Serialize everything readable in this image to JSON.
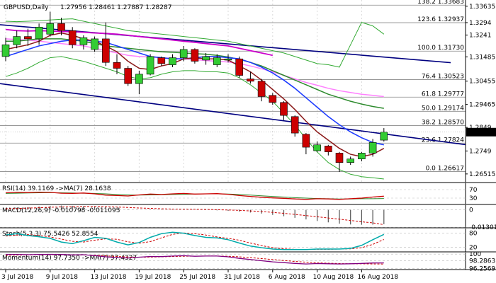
{
  "colors": {
    "bull": "#33cc33",
    "bear": "#cc0000",
    "wick": "#000000",
    "channel": "#000080",
    "ma_blue": "#1e3cff",
    "ma_brown": "#8b1a1a",
    "ma_green": "#2e8b2e",
    "ma_magenta": "#cc00cc",
    "ma_pink": "#ff80ff",
    "band_green": "#33aa33",
    "fib": "#888888",
    "grid": "#d8d8d8",
    "rsi_line": "#cc0000",
    "rsi_ma": "#2e8b2e",
    "stoch_k": "#00aaaa",
    "stoch_d": "#cc0000",
    "mom": "#800080",
    "mom_ma": "#cc0000",
    "price_tag": "#000000"
  },
  "header": {
    "symbol": "GBPUSD,Daily",
    "ohlc": "1.27956 1.28461 1.27887 1.28287"
  },
  "indicators": {
    "rsi": {
      "label": "RSI(14) 39.1169 ->MA(7) 28.1638",
      "ticks": [
        "70",
        "30"
      ]
    },
    "macd": {
      "label": "MACD(12,26,9) -0.010798 -0.011093",
      "ticks": [
        "0",
        "-0.01301"
      ]
    },
    "stoch": {
      "label": "Stoch(5,3,3) 75.5426 52.8554",
      "ticks": [
        "80",
        "20"
      ]
    },
    "momentum": {
      "label": "Momentum(14) 97.7350 ->MA(7) 97.4327",
      "ticks": [
        "100",
        "98.2863",
        "96.2569"
      ]
    }
  },
  "current_price": "1.28287",
  "chart_data": {
    "type": "candlestick",
    "title": "GBPUSD,Daily",
    "y_ticks": [
      1.33635,
      1.3294,
      1.3241,
      1.31485,
      1.30455,
      1.29465,
      1.2849,
      1.2749,
      1.26515
    ],
    "ylim": [
      1.2615,
      1.339
    ],
    "x_ticks": [
      "3 Jul 2018",
      "9 Jul 2018",
      "13 Jul 2018",
      "19 Jul 2018",
      "25 Jul 2018",
      "31 Jul 2018",
      "6 Aug 2018",
      "10 Aug 2018",
      "16 Aug 2018"
    ],
    "x_tick_index": [
      0,
      4,
      8,
      12,
      16,
      20,
      24,
      28,
      32
    ],
    "candles": [
      {
        "o": 1.315,
        "h": 1.323,
        "l": 1.313,
        "c": 1.32
      },
      {
        "o": 1.32,
        "h": 1.326,
        "l": 1.3185,
        "c": 1.3235
      },
      {
        "o": 1.3235,
        "h": 1.3268,
        "l": 1.3195,
        "c": 1.3225
      },
      {
        "o": 1.3225,
        "h": 1.329,
        "l": 1.32,
        "c": 1.3275
      },
      {
        "o": 1.3245,
        "h": 1.334,
        "l": 1.3235,
        "c": 1.329
      },
      {
        "o": 1.329,
        "h": 1.3315,
        "l": 1.324,
        "c": 1.326
      },
      {
        "o": 1.326,
        "h": 1.3275,
        "l": 1.3185,
        "c": 1.32
      },
      {
        "o": 1.32,
        "h": 1.324,
        "l": 1.318,
        "c": 1.323
      },
      {
        "o": 1.318,
        "h": 1.3235,
        "l": 1.317,
        "c": 1.3225
      },
      {
        "o": 1.3225,
        "h": 1.3295,
        "l": 1.311,
        "c": 1.3125
      },
      {
        "o": 1.3125,
        "h": 1.316,
        "l": 1.3075,
        "c": 1.31
      },
      {
        "o": 1.31,
        "h": 1.311,
        "l": 1.3025,
        "c": 1.3035
      },
      {
        "o": 1.3035,
        "h": 1.309,
        "l": 1.299,
        "c": 1.3075
      },
      {
        "o": 1.3075,
        "h": 1.316,
        "l": 1.307,
        "c": 1.315
      },
      {
        "o": 1.3145,
        "h": 1.315,
        "l": 1.311,
        "c": 1.312
      },
      {
        "o": 1.3115,
        "h": 1.316,
        "l": 1.3105,
        "c": 1.3145
      },
      {
        "o": 1.3145,
        "h": 1.3195,
        "l": 1.313,
        "c": 1.318
      },
      {
        "o": 1.318,
        "h": 1.3185,
        "l": 1.312,
        "c": 1.313
      },
      {
        "o": 1.3135,
        "h": 1.3165,
        "l": 1.3115,
        "c": 1.315
      },
      {
        "o": 1.3115,
        "h": 1.316,
        "l": 1.3105,
        "c": 1.3145
      },
      {
        "o": 1.3135,
        "h": 1.316,
        "l": 1.3125,
        "c": 1.314
      },
      {
        "o": 1.314,
        "h": 1.315,
        "l": 1.306,
        "c": 1.307
      },
      {
        "o": 1.3055,
        "h": 1.3085,
        "l": 1.3035,
        "c": 1.3045
      },
      {
        "o": 1.3045,
        "h": 1.3055,
        "l": 1.296,
        "c": 1.298
      },
      {
        "o": 1.2985,
        "h": 1.2995,
        "l": 1.2945,
        "c": 1.2955
      },
      {
        "o": 1.2955,
        "h": 1.296,
        "l": 1.288,
        "c": 1.29
      },
      {
        "o": 1.2895,
        "h": 1.29,
        "l": 1.281,
        "c": 1.2825
      },
      {
        "o": 1.282,
        "h": 1.2825,
        "l": 1.2735,
        "c": 1.2765
      },
      {
        "o": 1.275,
        "h": 1.279,
        "l": 1.2745,
        "c": 1.2775
      },
      {
        "o": 1.277,
        "h": 1.2775,
        "l": 1.273,
        "c": 1.2745
      },
      {
        "o": 1.274,
        "h": 1.2745,
        "l": 1.266,
        "c": 1.27
      },
      {
        "o": 1.27,
        "h": 1.2725,
        "l": 1.269,
        "c": 1.2715
      },
      {
        "o": 1.2715,
        "h": 1.2745,
        "l": 1.2705,
        "c": 1.274
      },
      {
        "o": 1.274,
        "h": 1.28,
        "l": 1.2725,
        "c": 1.2785
      },
      {
        "o": 1.2795,
        "h": 1.2846,
        "l": 1.2789,
        "c": 1.2829
      }
    ],
    "fib_levels": [
      {
        "label": "138.2 1.33683",
        "value": 1.33683
      },
      {
        "label": "123.6 1.32937",
        "value": 1.32937
      },
      {
        "label": "100.0 1.31730",
        "value": 1.3173
      },
      {
        "label": "76.4 1.30523",
        "value": 1.30523
      },
      {
        "label": "61.8 1.29777",
        "value": 1.29777
      },
      {
        "label": "50.0 1.29174",
        "value": 1.29174
      },
      {
        "label": "38.2 1.28570",
        "value": 1.2857
      },
      {
        "label": "23.6 1.27824",
        "value": 1.27824
      },
      {
        "label": "0.0 1.26617",
        "value": 1.26617
      }
    ],
    "channel_upper": [
      1.3285,
      1.3124
    ],
    "channel_lower": [
      1.3035,
      1.2776
    ],
    "ma_fast": [
      1.318,
      1.319,
      1.32,
      1.3215,
      1.324,
      1.325,
      1.324,
      1.3225,
      1.3215,
      1.3195,
      1.317,
      1.313,
      1.31,
      1.3095,
      1.311,
      1.312,
      1.314,
      1.3145,
      1.314,
      1.314,
      1.3135,
      1.311,
      1.3085,
      1.305,
      1.301,
      1.297,
      1.2925,
      1.2875,
      1.283,
      1.2795,
      1.276,
      1.2735,
      1.2725,
      1.2735,
      1.276
    ],
    "ma_blue": [
      1.315,
      1.3165,
      1.318,
      1.3195,
      1.3205,
      1.3215,
      1.322,
      1.322,
      1.3215,
      1.321,
      1.3195,
      1.318,
      1.3165,
      1.315,
      1.3145,
      1.314,
      1.314,
      1.3145,
      1.315,
      1.315,
      1.3145,
      1.314,
      1.3125,
      1.3105,
      1.308,
      1.305,
      1.3015,
      1.2975,
      1.2935,
      1.2895,
      1.286,
      1.283,
      1.2805,
      1.2785,
      1.2775
    ],
    "ma_green": [
      1.3215,
      1.3215,
      1.322,
      1.3225,
      1.3225,
      1.3225,
      1.322,
      1.3215,
      1.3205,
      1.3195,
      1.319,
      1.3185,
      1.318,
      1.3175,
      1.317,
      1.3168,
      1.3165,
      1.3162,
      1.316,
      1.3155,
      1.3148,
      1.3138,
      1.3125,
      1.311,
      1.309,
      1.307,
      1.305,
      1.303,
      1.301,
      1.299,
      1.2975,
      1.296,
      1.2948,
      1.2938,
      1.293
    ],
    "ma_magenta": [
      1.3265,
      1.326,
      1.3258,
      1.326,
      1.3258,
      1.3256,
      1.3255,
      1.3253,
      1.325,
      1.3248,
      1.3245,
      1.324,
      1.3235,
      1.323,
      1.3225,
      1.322,
      1.3215,
      1.321,
      1.3205,
      1.32,
      1.3195,
      1.3185,
      1.3175,
      1.3165,
      1.3155
    ],
    "ma_pink": [
      1.3225,
      1.3222,
      1.322,
      1.3215,
      1.321,
      1.3205,
      1.32,
      1.3195,
      1.3185,
      1.3175,
      1.3165,
      1.3155,
      1.315,
      1.3148,
      1.3145,
      1.3142,
      1.314,
      1.3137,
      1.3133,
      1.313,
      1.3127,
      1.312,
      1.311,
      1.3098,
      1.3085,
      1.307,
      1.3055,
      1.304,
      1.3028,
      1.3015,
      1.3005,
      1.2997,
      1.299,
      1.2985,
      1.298
    ],
    "band_upper": [
      1.33,
      1.3298,
      1.33,
      1.3302,
      1.3305,
      1.3308,
      1.331,
      1.33,
      1.329,
      1.328,
      1.327,
      1.326,
      1.3255,
      1.325,
      1.3245,
      1.324,
      1.3235,
      1.323,
      1.3225,
      1.322,
      1.3215,
      1.3205,
      1.3195,
      1.3185,
      1.3175,
      1.3165,
      1.315,
      1.3135,
      1.312,
      1.3115,
      1.3105,
      1.32,
      1.3295,
      1.328,
      1.3245
    ],
    "band_lower": [
      1.3065,
      1.308,
      1.31,
      1.3125,
      1.3145,
      1.315,
      1.314,
      1.313,
      1.3115,
      1.31,
      1.3085,
      1.3065,
      1.3055,
      1.306,
      1.3075,
      1.3085,
      1.309,
      1.309,
      1.3085,
      1.3085,
      1.308,
      1.306,
      1.303,
      1.2995,
      1.296,
      1.291,
      1.286,
      1.28,
      1.2745,
      1.27,
      1.267,
      1.265,
      1.264,
      1.2635,
      1.263
    ],
    "rsi": {
      "ylim": [
        0,
        100
      ],
      "rsi": [
        55,
        57,
        56,
        58,
        57,
        53,
        52,
        54,
        50,
        44,
        42,
        40,
        45,
        49,
        47,
        50,
        52,
        49,
        50,
        51,
        48,
        42,
        38,
        34,
        31,
        29,
        26,
        24,
        27,
        26,
        24,
        27,
        30,
        35,
        39
      ],
      "ma": [
        52,
        53,
        54,
        55,
        56,
        55,
        54,
        53,
        52,
        50,
        47,
        45,
        44,
        45,
        46,
        47,
        48,
        49,
        50,
        50,
        49,
        47,
        44,
        41,
        38,
        35,
        32,
        30,
        28,
        27,
        26,
        26,
        27,
        27,
        28
      ]
    },
    "macd": {
      "hist": [
        0.001,
        0.0015,
        0.002,
        0.0025,
        0.003,
        0.0032,
        0.003,
        0.0028,
        0.0025,
        0.002,
        0.0012,
        0.0004,
        0.0,
        -0.0002,
        -0.0002,
        -0.0001,
        0.0,
        0.0,
        -0.0002,
        -0.0004,
        -0.0008,
        -0.0013,
        -0.002,
        -0.0028,
        -0.0038,
        -0.0048,
        -0.006,
        -0.0072,
        -0.0084,
        -0.0094,
        -0.0104,
        -0.011,
        -0.0112,
        -0.0111,
        -0.0108
      ],
      "signal": [
        0.0008,
        0.001,
        0.0013,
        0.0016,
        0.0019,
        0.0022,
        0.0024,
        0.0025,
        0.0025,
        0.0024,
        0.0021,
        0.0018,
        0.0014,
        0.0011,
        0.0008,
        0.0006,
        0.0005,
        0.0004,
        0.0003,
        0.0001,
        -0.0001,
        -0.0004,
        -0.0008,
        -0.0013,
        -0.0019,
        -0.0026,
        -0.0034,
        -0.0043,
        -0.0052,
        -0.0061,
        -0.007,
        -0.008,
        -0.009,
        -0.0098,
        -0.0111
      ],
      "ylim": [
        -0.0135,
        0.0035
      ]
    },
    "stoch": {
      "ylim": [
        0,
        100
      ],
      "k": [
        72,
        78,
        70,
        65,
        58,
        42,
        35,
        48,
        62,
        58,
        42,
        30,
        40,
        62,
        78,
        84,
        80,
        70,
        62,
        60,
        52,
        38,
        25,
        18,
        12,
        10,
        10,
        10,
        12,
        12,
        12,
        15,
        28,
        52,
        75
      ],
      "d": [
        68,
        72,
        74,
        70,
        64,
        55,
        45,
        42,
        50,
        56,
        54,
        43,
        37,
        44,
        60,
        75,
        81,
        78,
        72,
        64,
        58,
        50,
        38,
        27,
        18,
        13,
        11,
        10,
        11,
        11,
        12,
        13,
        18,
        32,
        53
      ]
    },
    "momentum": {
      "ylim": [
        96.0,
        100.4
      ],
      "mom": [
        99.95,
        99.9,
        99.85,
        99.9,
        99.95,
        99.9,
        99.8,
        99.85,
        99.6,
        99.3,
        99.1,
        99.0,
        99.2,
        99.4,
        99.35,
        99.5,
        99.6,
        99.45,
        99.5,
        99.5,
        99.3,
        98.9,
        98.6,
        98.3,
        98.0,
        97.8,
        97.6,
        97.45,
        97.55,
        97.5,
        97.45,
        97.5,
        97.6,
        97.7,
        97.73
      ],
      "ma": [
        99.7,
        99.75,
        99.8,
        99.85,
        99.88,
        99.87,
        99.85,
        99.8,
        99.7,
        99.55,
        99.4,
        99.25,
        99.2,
        99.22,
        99.3,
        99.38,
        99.45,
        99.48,
        99.5,
        99.5,
        99.45,
        99.3,
        99.1,
        98.85,
        98.6,
        98.35,
        98.1,
        97.9,
        97.75,
        97.65,
        97.55,
        97.5,
        97.48,
        97.45,
        97.43
      ]
    }
  }
}
